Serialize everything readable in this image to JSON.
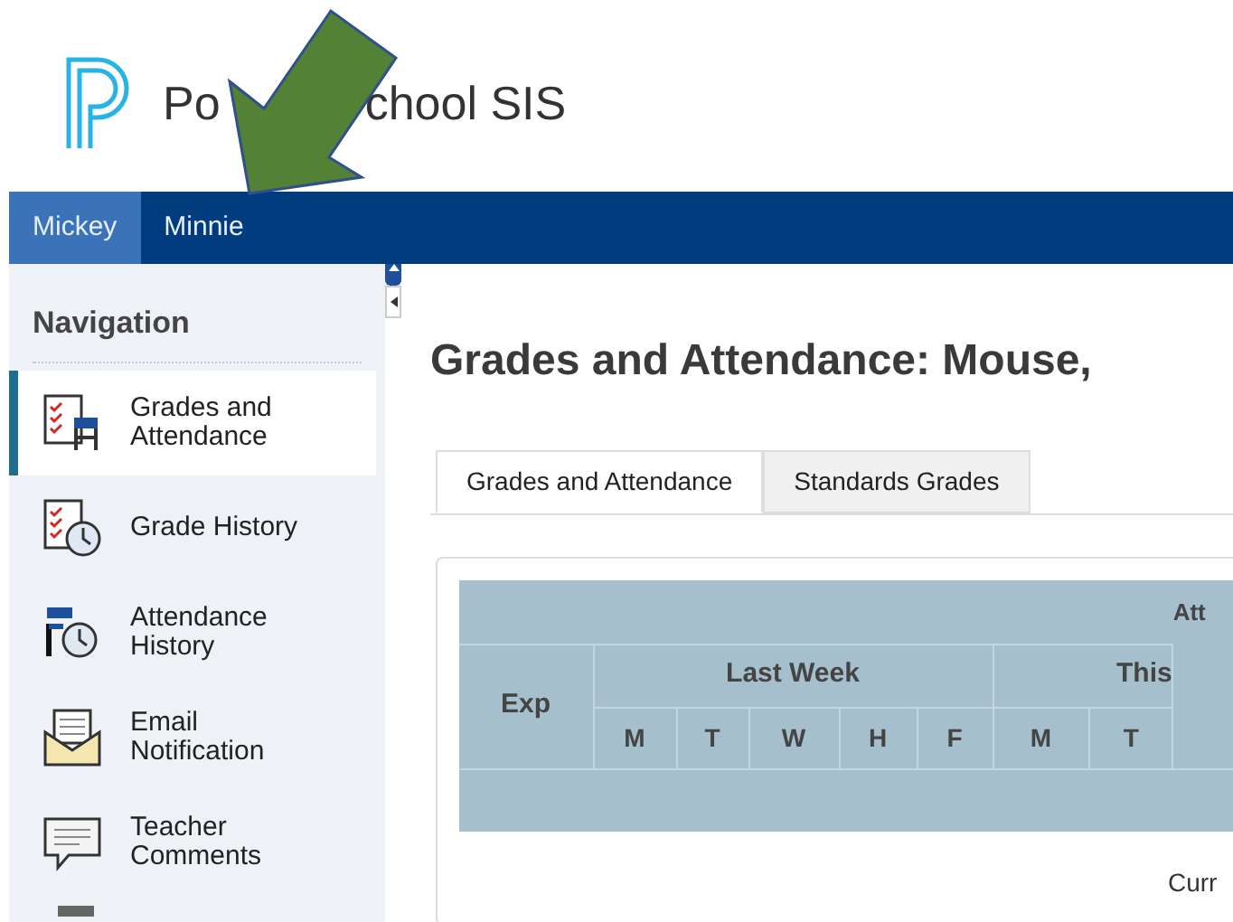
{
  "logo": {
    "text_before": "Po",
    "text_after": "chool SIS"
  },
  "user_tabs": [
    {
      "label": "Mickey",
      "selected": true
    },
    {
      "label": "Minnie",
      "selected": false
    }
  ],
  "navigation": {
    "title": "Navigation",
    "items": [
      {
        "label": "Grades and Attendance",
        "kind": "grades",
        "selected": true
      },
      {
        "label": "Grade History",
        "kind": "history",
        "selected": false
      },
      {
        "label": "Attendance History",
        "kind": "attendance",
        "selected": false
      },
      {
        "label": "Email Notification",
        "kind": "email",
        "selected": false
      },
      {
        "label": "Teacher Comments",
        "kind": "comments",
        "selected": false
      }
    ]
  },
  "page_title": "Grades and Attendance: Mouse,",
  "tabs": [
    {
      "label": "Grades and Attendance",
      "selected": true
    },
    {
      "label": "Standards Grades",
      "selected": false
    }
  ],
  "table": {
    "group_header": "Att",
    "exp_header": "Exp",
    "weeks": [
      {
        "label": "Last Week",
        "days": [
          "M",
          "T",
          "W",
          "H",
          "F"
        ]
      },
      {
        "label": "This",
        "days": [
          "M",
          "T"
        ]
      }
    ]
  },
  "footer_text": "Curr"
}
